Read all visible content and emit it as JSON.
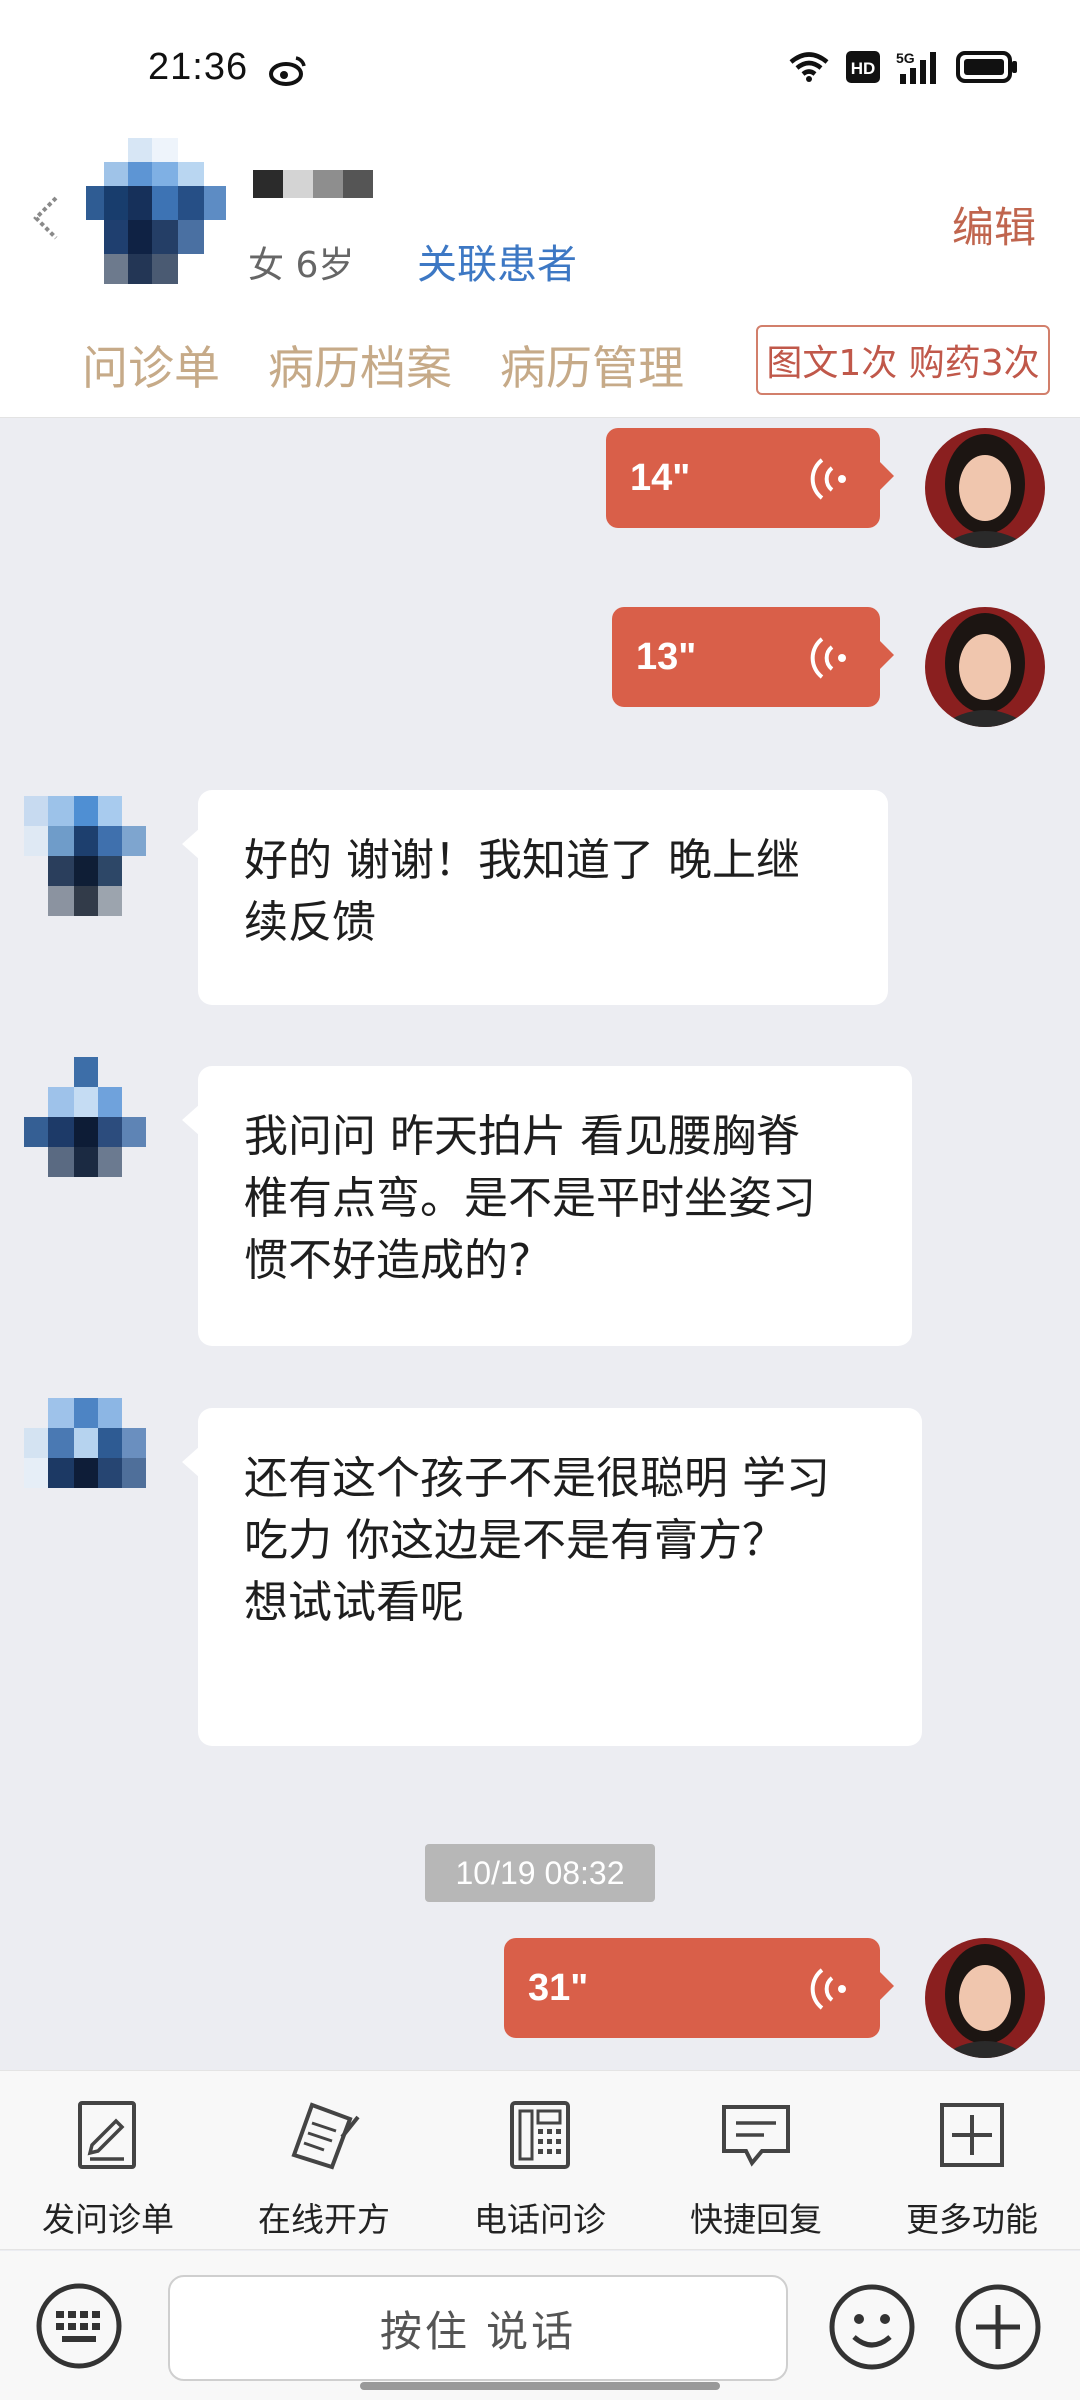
{
  "status_bar": {
    "time": "21:36",
    "left_icon": "weibo-icon",
    "right_icons": [
      "wifi-icon",
      "hd-icon",
      "5g-signal-icon",
      "battery-icon"
    ],
    "hd": "HD",
    "net": "5G"
  },
  "header": {
    "patient_meta": "女 6岁",
    "link_patient": "关联患者",
    "edit": "编辑"
  },
  "tabs": [
    "问诊单",
    "病历档案",
    "病历管理"
  ],
  "purchase_badge": "图文1次 购药3次",
  "messages": [
    {
      "type": "voice",
      "from": "doctor",
      "duration": "14\""
    },
    {
      "type": "voice",
      "from": "doctor",
      "duration": "13\""
    },
    {
      "type": "text",
      "from": "patient",
      "lines": [
        "好的 谢谢！我知道了 晚上继",
        "续反馈"
      ]
    },
    {
      "type": "text",
      "from": "patient",
      "lines": [
        "我问问 昨天拍片 看见腰胸脊",
        "椎有点弯。是不是平时坐姿习",
        "惯不好造成的?"
      ]
    },
    {
      "type": "text",
      "from": "patient",
      "lines": [
        "还有这个孩子不是很聪明 学习",
        "吃力 你这边是不是有膏方？",
        "想试试看呢"
      ]
    },
    {
      "type": "timestamp",
      "text": "10/19 08:32"
    },
    {
      "type": "voice",
      "from": "doctor",
      "duration": "31\""
    }
  ],
  "actions": [
    {
      "label": "发问诊单",
      "icon": "form-edit-icon"
    },
    {
      "label": "在线开方",
      "icon": "prescription-icon"
    },
    {
      "label": "电话问诊",
      "icon": "phone-icon"
    },
    {
      "label": "快捷回复",
      "icon": "chat-bubble-icon"
    },
    {
      "label": "更多功能",
      "icon": "plus-square-icon"
    }
  ],
  "input_bar": {
    "hold_to_talk": "按住 说话",
    "left_icon": "keyboard-icon",
    "right_icons": [
      "emoji-icon",
      "plus-circle-icon"
    ]
  },
  "colors": {
    "voice_bubble": "#d95f49",
    "tab_text": "#c6aa88",
    "link": "#3d78c4",
    "edit": "#c0654e",
    "background": "#ecedf2"
  }
}
